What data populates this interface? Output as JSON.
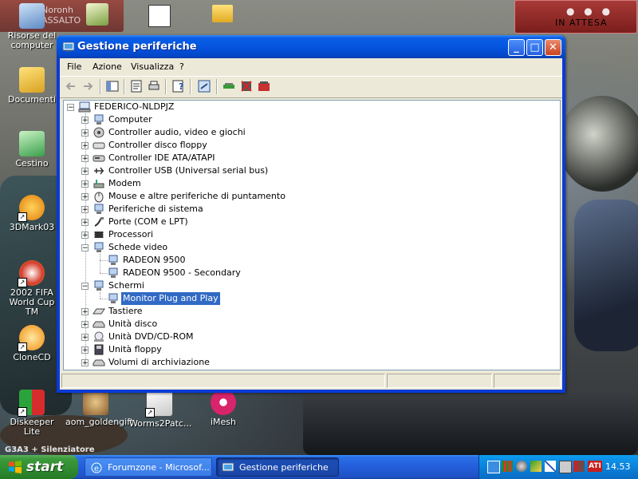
{
  "overlay": {
    "top_left_text": "Noronh\nASSALTO",
    "top_right_text": "IN ATTESA",
    "top_right_dots": "● ● ●",
    "bottom_left_text": "G3A3 + Silenziatore"
  },
  "desktop": {
    "icons": [
      {
        "label": "Risorse del computer",
        "icon": "my-computer-icon"
      },
      {
        "label": "Documenti",
        "icon": "my-documents-icon"
      },
      {
        "label": "Cestino",
        "icon": "recycle-bin-icon"
      },
      {
        "label": "3DMark03",
        "icon": "3dmark-icon"
      },
      {
        "label": "2002 FIFA World Cup TM",
        "icon": "fifa-icon"
      },
      {
        "label": "CloneCD",
        "icon": "clonecd-icon"
      },
      {
        "label": "Diskeeper Lite",
        "icon": "diskeeper-icon"
      },
      {
        "label": "aom_goldengift",
        "icon": "aom-icon"
      },
      {
        "label": "Worms2Patc...",
        "icon": "worms-icon"
      },
      {
        "label": "iMesh",
        "icon": "imesh-icon"
      }
    ]
  },
  "window": {
    "title": "Gestione periferiche",
    "controls": {
      "minimize": "_",
      "maximize": "□",
      "close": "✕"
    },
    "menu": [
      "File",
      "Azione",
      "Visualizza",
      "?"
    ],
    "tree": {
      "root": "FEDERICO-NLDPJZ",
      "items": [
        {
          "label": "Computer",
          "expander": "+",
          "icon": "computer-icon"
        },
        {
          "label": "Controller audio, video e giochi",
          "expander": "+",
          "icon": "audio-icon"
        },
        {
          "label": "Controller disco floppy",
          "expander": "+",
          "icon": "floppy-controller-icon"
        },
        {
          "label": "Controller IDE ATA/ATAPI",
          "expander": "+",
          "icon": "ide-icon"
        },
        {
          "label": "Controller USB (Universal serial bus)",
          "expander": "+",
          "icon": "usb-icon"
        },
        {
          "label": "Modem",
          "expander": "+",
          "icon": "modem-icon"
        },
        {
          "label": "Mouse e altre periferiche di puntamento",
          "expander": "+",
          "icon": "mouse-icon"
        },
        {
          "label": "Periferiche di sistema",
          "expander": "+",
          "icon": "system-devices-icon"
        },
        {
          "label": "Porte (COM e LPT)",
          "expander": "+",
          "icon": "ports-icon"
        },
        {
          "label": "Processori",
          "expander": "+",
          "icon": "processor-icon"
        },
        {
          "label": "Schede video",
          "expander": "−",
          "icon": "display-adapter-icon",
          "children": [
            "RADEON 9500",
            "RADEON 9500 - Secondary"
          ]
        },
        {
          "label": "Schermi",
          "expander": "−",
          "icon": "monitor-icon",
          "children": [
            "Monitor Plug and Play"
          ]
        },
        {
          "label": "Tastiere",
          "expander": "+",
          "icon": "keyboard-icon"
        },
        {
          "label": "Unità disco",
          "expander": "+",
          "icon": "disk-drive-icon"
        },
        {
          "label": "Unità DVD/CD-ROM",
          "expander": "+",
          "icon": "cdrom-icon"
        },
        {
          "label": "Unità floppy",
          "expander": "+",
          "icon": "floppy-drive-icon"
        },
        {
          "label": "Volumi di archiviazione",
          "expander": "+",
          "icon": "storage-volume-icon"
        }
      ],
      "selected": "Monitor Plug and Play"
    }
  },
  "taskbar": {
    "start_label": "start",
    "items": [
      {
        "label": "Forumzone - Microsof...",
        "icon": "ie-icon",
        "active": false
      },
      {
        "label": "Gestione periferiche",
        "icon": "device-manager-icon",
        "active": true
      }
    ],
    "clock": "14.53"
  }
}
